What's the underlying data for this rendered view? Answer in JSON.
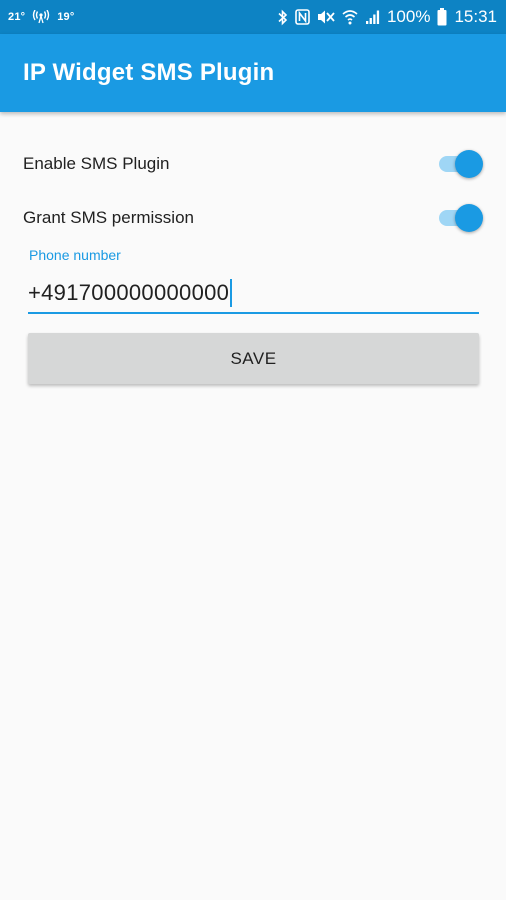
{
  "status_bar": {
    "temp_1": "21°",
    "temp_2": "19°",
    "battery": "100%",
    "time": "15:31"
  },
  "app_bar": {
    "title": "IP Widget SMS Plugin"
  },
  "settings": {
    "enable_sms": {
      "label": "Enable SMS Plugin",
      "enabled": true
    },
    "grant_permission": {
      "label": "Grant SMS permission",
      "enabled": true
    }
  },
  "phone": {
    "label": "Phone number",
    "value": "+491700000000000"
  },
  "save_button": {
    "label": "SAVE"
  },
  "colors": {
    "primary": "#1a9ae3",
    "status_bar": "#0d83c4",
    "background": "#fafafa",
    "button": "#d6d7d7"
  }
}
